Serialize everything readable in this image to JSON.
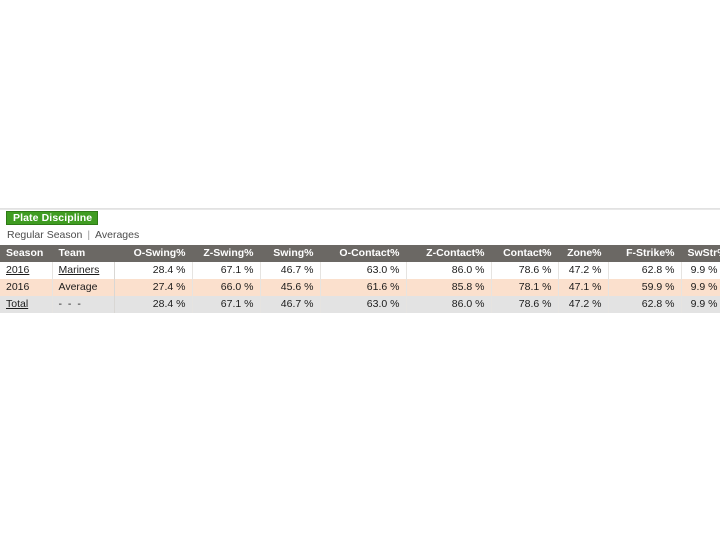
{
  "panel": {
    "tab_label": "Plate Discipline",
    "tab_color": "#3f9c21",
    "tab_text_color": "#ffffff",
    "subnav": {
      "primary": "Regular Season",
      "separator": "|",
      "secondary": "Averages"
    }
  },
  "table": {
    "header_bg": "#6b6864",
    "average_row_bg": "#fbe0cd",
    "total_row_bg": "#e3e3e3",
    "columns": [
      "Season",
      "Team",
      "O-Swing%",
      "Z-Swing%",
      "Swing%",
      "O-Contact%",
      "Z-Contact%",
      "Contact%",
      "Zone%",
      "F-Strike%",
      "SwStr%"
    ],
    "rows": [
      {
        "style": "row-white",
        "season": "2016",
        "team": "Mariners",
        "season_link": true,
        "team_link": true,
        "values": [
          "28.4 %",
          "67.1 %",
          "46.7 %",
          "63.0 %",
          "86.0 %",
          "78.6 %",
          "47.2 %",
          "62.8 %",
          "9.9 %"
        ]
      },
      {
        "style": "row-avg",
        "season": "2016",
        "team": "Average",
        "season_link": false,
        "team_link": false,
        "values": [
          "27.4 %",
          "66.0 %",
          "45.6 %",
          "61.6 %",
          "85.8 %",
          "78.1 %",
          "47.1 %",
          "59.9 %",
          "9.9 %"
        ]
      },
      {
        "style": "row-total",
        "season": "Total",
        "team": "- - -",
        "season_link": true,
        "team_link": false,
        "values": [
          "28.4 %",
          "67.1 %",
          "46.7 %",
          "63.0 %",
          "86.0 %",
          "78.6 %",
          "47.2 %",
          "62.8 %",
          "9.9 %"
        ]
      }
    ]
  }
}
